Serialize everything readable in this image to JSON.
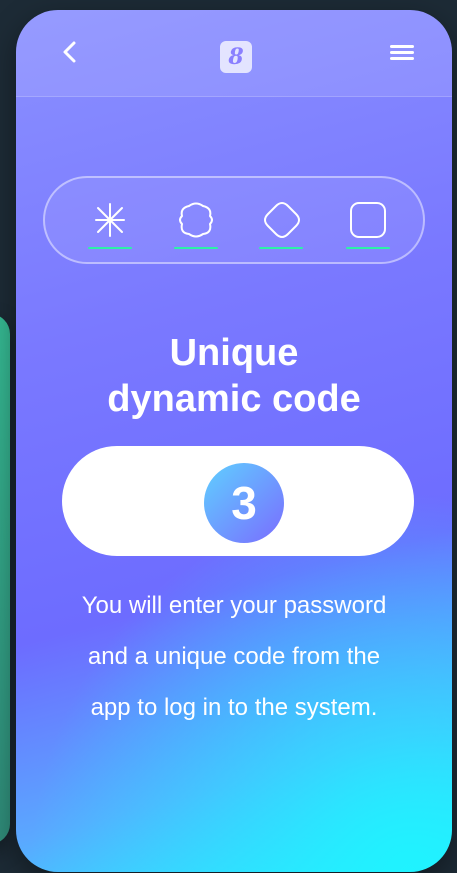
{
  "header": {
    "back_icon": "chevron-left-icon",
    "logo_glyph": "8",
    "menu_icon": "hamburger-icon"
  },
  "security_methods": [
    {
      "icon": "asterisk-icon"
    },
    {
      "icon": "flower-icon"
    },
    {
      "icon": "diamond-icon"
    },
    {
      "icon": "square-icon"
    }
  ],
  "main": {
    "title_line1": "Unique",
    "title_line2": "dynamic code",
    "code_digit": "3",
    "description_line1": "You will enter your password",
    "description_line2": "and a unique code from the",
    "description_line3": "app to log in to the system."
  },
  "colors": {
    "accent_underline": "#2cf2a6",
    "gradient_top": "#8a90ff",
    "gradient_bottom": "#2ee7ff",
    "side_card": "#35b992"
  }
}
